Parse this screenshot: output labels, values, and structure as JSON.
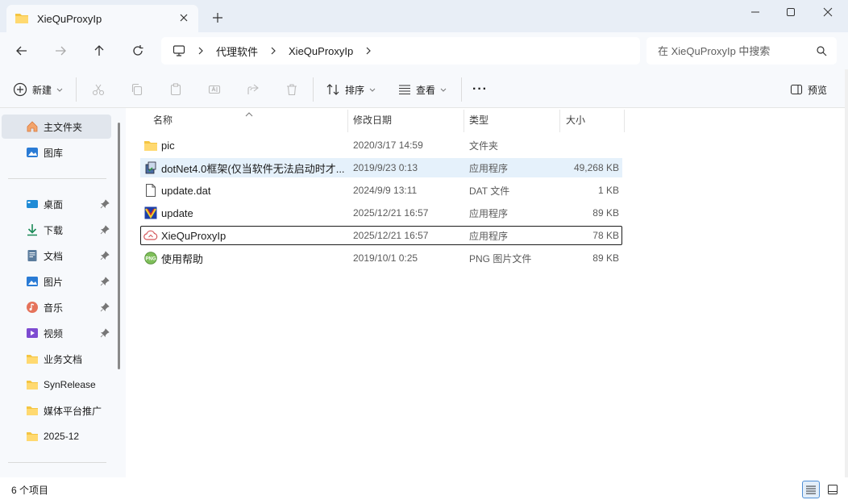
{
  "window": {
    "tab_title": "XieQuProxyIp",
    "close_tab_icon": "close-icon",
    "new_tab_icon": "plus-icon",
    "minimize_icon": "minimize-icon",
    "maximize_icon": "maximize-icon",
    "close_icon": "close-icon"
  },
  "nav": {
    "back_icon": "arrow-left-icon",
    "forward_icon": "arrow-right-icon",
    "up_icon": "arrow-up-icon",
    "refresh_icon": "refresh-icon",
    "breadcrumb": [
      "代理软件",
      "XieQuProxyIp"
    ],
    "search_placeholder": "在 XieQuProxyIp 中搜索"
  },
  "toolbar": {
    "new_label": "新建",
    "sort_label": "排序",
    "view_label": "查看",
    "more_label": "···",
    "preview_label": "预览",
    "disabled_icons": [
      "cut-icon",
      "copy-icon",
      "paste-icon",
      "rename-icon",
      "share-icon",
      "delete-icon"
    ]
  },
  "sidebar": {
    "top_items": [
      {
        "label": "主文件夹",
        "icon": "home-icon",
        "active": true
      },
      {
        "label": "图库",
        "icon": "gallery-icon",
        "active": false
      }
    ],
    "pinned_items": [
      {
        "label": "桌面",
        "icon": "desktop-icon",
        "pinned": true
      },
      {
        "label": "下载",
        "icon": "download-icon",
        "pinned": true
      },
      {
        "label": "文档",
        "icon": "document-icon",
        "pinned": true
      },
      {
        "label": "图片",
        "icon": "picture-icon",
        "pinned": true
      },
      {
        "label": "音乐",
        "icon": "music-icon",
        "pinned": true
      },
      {
        "label": "视频",
        "icon": "video-icon",
        "pinned": true
      },
      {
        "label": "业务文档",
        "icon": "folder-icon",
        "pinned": false
      },
      {
        "label": "SynRelease",
        "icon": "folder-icon",
        "pinned": false
      },
      {
        "label": "媒体平台推广",
        "icon": "folder-icon",
        "pinned": false
      },
      {
        "label": "2025-12",
        "icon": "folder-icon",
        "pinned": false
      }
    ]
  },
  "columns": [
    "名称",
    "修改日期",
    "类型",
    "大小"
  ],
  "files": [
    {
      "name": "pic",
      "date": "2020/3/17 14:59",
      "type": "文件夹",
      "size": "",
      "icon": "folder-icon"
    },
    {
      "name": "dotNet4.0框架(仅当软件无法启动时才...",
      "date": "2019/9/23 0:13",
      "type": "应用程序",
      "size": "49,268 KB",
      "icon": "installer-icon"
    },
    {
      "name": "update.dat",
      "date": "2024/9/9 13:11",
      "type": "DAT 文件",
      "size": "1 KB",
      "icon": "file-icon"
    },
    {
      "name": "update",
      "date": "2025/12/21 16:57",
      "type": "应用程序",
      "size": "89 KB",
      "icon": "app-update-icon"
    },
    {
      "name": "XieQuProxyIp",
      "date": "2025/12/21 16:57",
      "type": "应用程序",
      "size": "78 KB",
      "icon": "cloud-app-icon"
    },
    {
      "name": "使用帮助",
      "date": "2019/10/1 0:25",
      "type": "PNG 图片文件",
      "size": "89 KB",
      "icon": "png-icon"
    }
  ],
  "status": {
    "count_text": "6 个项目"
  },
  "colors": {
    "accent": "#0067c0",
    "folder": "#f4c542",
    "hover_row": "#e5f1fb",
    "chrome": "#f7f9fc"
  }
}
